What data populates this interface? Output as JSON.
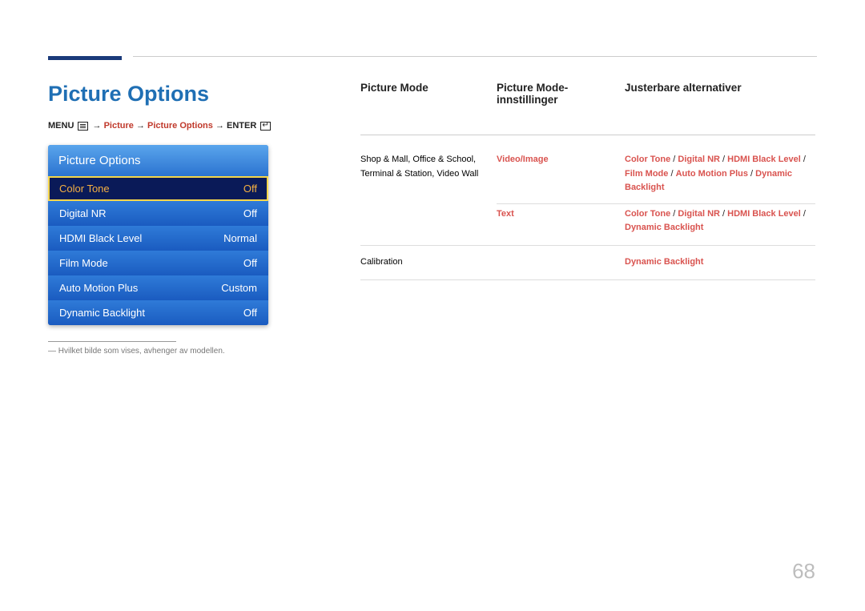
{
  "page_number": "68",
  "title": "Picture Options",
  "breadcrumb": {
    "menu": "MENU",
    "arrow": "→",
    "picture": "Picture",
    "picture_options": "Picture Options",
    "enter": "ENTER"
  },
  "panel": {
    "title": "Picture Options",
    "items": [
      {
        "label": "Color Tone",
        "value": "Off",
        "selected": true
      },
      {
        "label": "Digital NR",
        "value": "Off",
        "selected": false
      },
      {
        "label": "HDMI Black Level",
        "value": "Normal",
        "selected": false
      },
      {
        "label": "Film Mode",
        "value": "Off",
        "selected": false
      },
      {
        "label": "Auto Motion Plus",
        "value": "Custom",
        "selected": false
      },
      {
        "label": "Dynamic Backlight",
        "value": "Off",
        "selected": false
      }
    ]
  },
  "footnote": "― Hvilket bilde som vises, avhenger av modellen.",
  "table": {
    "headers": {
      "col1": "Picture Mode",
      "col2": "Picture Mode-innstillinger",
      "col3": "Justerbare alternativer"
    },
    "rows": [
      {
        "col1": "Shop & Mall, Office & School, Terminal & Station, Video Wall",
        "sub": [
          {
            "col2": "Video/Image",
            "col3_parts": [
              {
                "t": "Color Tone",
                "c": "orange"
              },
              {
                "t": " / ",
                "c": "black"
              },
              {
                "t": "Digital NR",
                "c": "orange"
              },
              {
                "t": " / ",
                "c": "black"
              },
              {
                "t": "HDMI Black Level",
                "c": "orange"
              },
              {
                "t": " / ",
                "c": "black"
              },
              {
                "t": "Film Mode",
                "c": "orange"
              },
              {
                "t": " / ",
                "c": "black"
              },
              {
                "t": "Auto Motion Plus",
                "c": "orange"
              },
              {
                "t": " / ",
                "c": "black"
              },
              {
                "t": "Dynamic Backlight",
                "c": "orange"
              }
            ]
          },
          {
            "col2": "Text",
            "col3_parts": [
              {
                "t": "Color Tone",
                "c": "orange"
              },
              {
                "t": " / ",
                "c": "black"
              },
              {
                "t": "Digital NR",
                "c": "orange"
              },
              {
                "t": " / ",
                "c": "black"
              },
              {
                "t": "HDMI Black Level",
                "c": "orange"
              },
              {
                "t": " / ",
                "c": "black"
              },
              {
                "t": "Dynamic Backlight",
                "c": "orange"
              }
            ]
          }
        ]
      },
      {
        "col1": "Calibration",
        "sub": [
          {
            "col2": "",
            "col3_parts": [
              {
                "t": "Dynamic Backlight",
                "c": "orange"
              }
            ]
          }
        ]
      }
    ]
  }
}
